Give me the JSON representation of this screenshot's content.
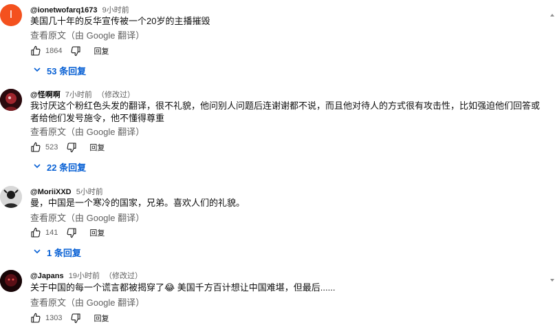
{
  "comments": [
    {
      "avatar_letter": "I",
      "author": "@ionetwofarq1673",
      "time": "9小时前",
      "edited": "",
      "text": "美国几十年的反华宣传被一个20岁的主播摧毁",
      "translate": "查看原文（由 Google 翻译）",
      "likes": "1864",
      "reply_label": "回复",
      "replies": "53 条回复"
    },
    {
      "avatar_letter": "",
      "author": "@怪啊啊",
      "time": "7小时前",
      "edited": "（修改过）",
      "text": "我讨厌这个粉红色头发的翻译，很不礼貌，他问别人问题后连谢谢都不说，而且他对待人的方式很有攻击性，比如强迫他们回答或者给他们发号施令，他不懂得尊重",
      "translate": "查看原文（由 Google 翻译）",
      "likes": "523",
      "reply_label": "回复",
      "replies": "22 条回复"
    },
    {
      "avatar_letter": "",
      "author": "@MoriiXXD",
      "time": "5小时前",
      "edited": "",
      "text": "曼，中国是一个寒冷的国家，兄弟。喜欢人们的礼貌。",
      "translate": "查看原文（由 Google 翻译）",
      "likes": "141",
      "reply_label": "回复",
      "replies": "1 条回复"
    },
    {
      "avatar_letter": "",
      "author": "@Japans",
      "time": "19小时前",
      "edited": "（修改过）",
      "text": "关于中国的每一个谎言都被揭穿了😂 美国千方百计想让中国难堪，但最后......",
      "translate": "查看原文（由 Google 翻译）",
      "likes": "1303",
      "reply_label": "回复",
      "replies": ""
    }
  ],
  "colors": {
    "link_blue": "#065fd4",
    "meta_gray": "#606060",
    "avatar_orange": "#f4511e"
  },
  "icons": [
    "like-icon",
    "dislike-icon",
    "chevron-down-icon"
  ]
}
